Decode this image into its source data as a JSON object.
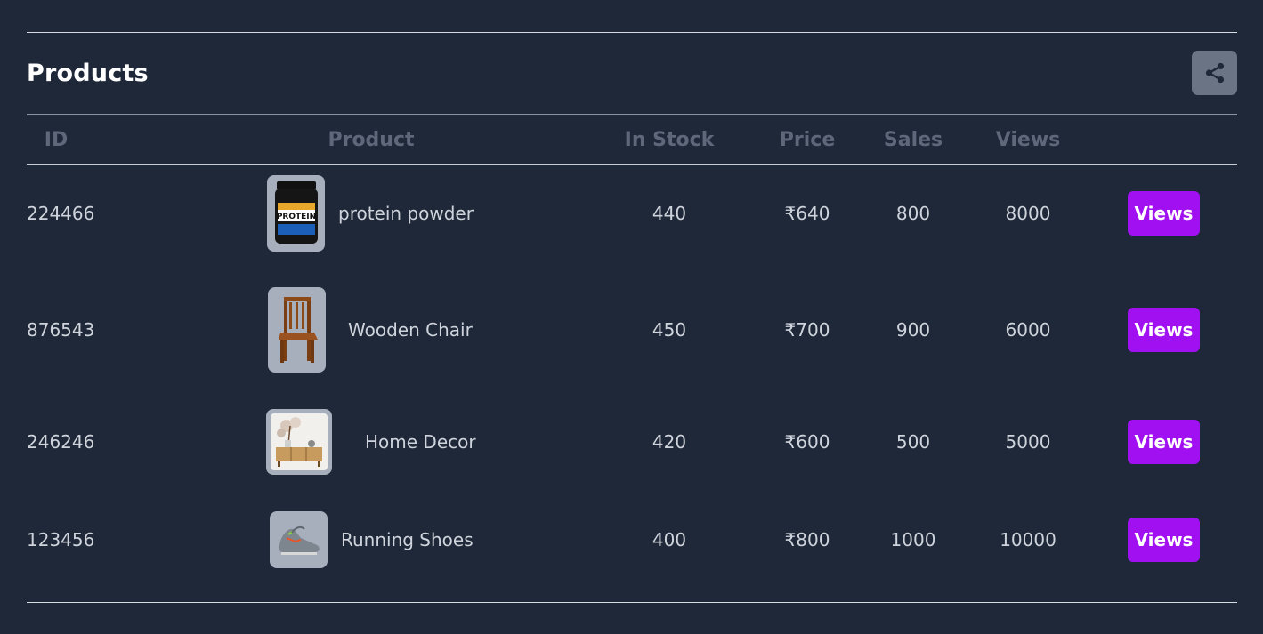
{
  "title": "Products",
  "share": {
    "icon": "share-icon"
  },
  "columns": [
    "ID",
    "Product",
    "In Stock",
    "Price",
    "Sales",
    "Views"
  ],
  "rows": [
    {
      "id": "224466",
      "product": "protein powder",
      "image": "protein-tub",
      "in_stock": "440",
      "price": "₹640",
      "sales": "800",
      "views": "8000",
      "action": "Views"
    },
    {
      "id": "876543",
      "product": "Wooden Chair",
      "image": "wooden-chair",
      "in_stock": "450",
      "price": "₹700",
      "sales": "900",
      "views": "6000",
      "action": "Views"
    },
    {
      "id": "246246",
      "product": "Home Decor",
      "image": "home-decor",
      "in_stock": "420",
      "price": "₹600",
      "sales": "500",
      "views": "5000",
      "action": "Views"
    },
    {
      "id": "123456",
      "product": "Running Shoes",
      "image": "running-shoes",
      "in_stock": "400",
      "price": "₹800",
      "sales": "1000",
      "views": "10000",
      "action": "Views"
    }
  ],
  "colors": {
    "background": "#1f2839",
    "accent": "#a010f0",
    "header_text": "#5e687a",
    "cell_text": "#cfd4dc"
  }
}
